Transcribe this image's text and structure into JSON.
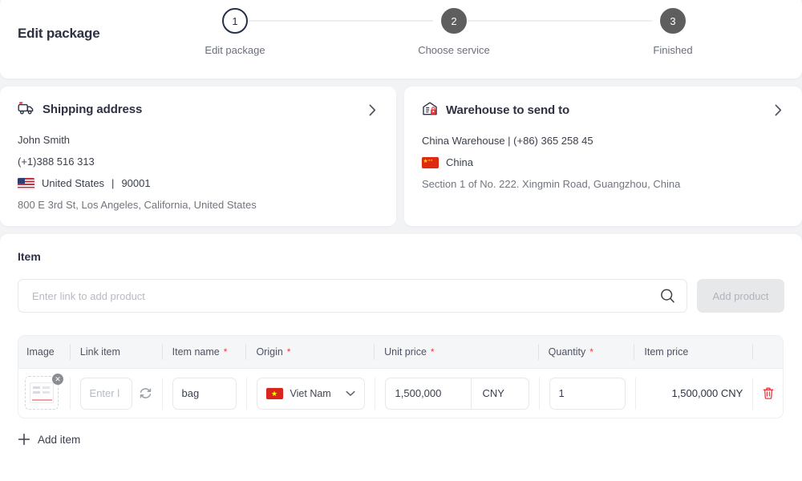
{
  "header": {
    "title": "Edit package",
    "steps": [
      {
        "number": "1",
        "label": "Edit package",
        "state": "active"
      },
      {
        "number": "2",
        "label": "Choose service",
        "state": "inactive"
      },
      {
        "number": "3",
        "label": "Finished",
        "state": "inactive"
      }
    ]
  },
  "shipping_address": {
    "heading": "Shipping address",
    "icon": "truck-icon",
    "name": "John Smith",
    "phone": "(+1)388 516 313",
    "country": "United States",
    "separator": "|",
    "postal_code": "90001",
    "address": "800 E 3rd St, Los Angeles, California, United States",
    "flag": "us-flag-icon"
  },
  "warehouse": {
    "heading": "Warehouse to send to",
    "icon": "warehouse-icon",
    "name_and_phone": "China Warehouse  |  (+86) 365 258 45",
    "country": "China",
    "address": "Section 1 of No. 222. Xingmin Road, Guangzhou, China",
    "flag": "cn-flag-icon"
  },
  "item_section": {
    "title": "Item",
    "search_placeholder": "Enter link to add product",
    "search_value": "",
    "add_product_label": "Add product",
    "add_item_label": "Add item",
    "table": {
      "columns": [
        {
          "label": "Image",
          "required": false
        },
        {
          "label": "Link item",
          "required": false
        },
        {
          "label": "Item name",
          "required": true
        },
        {
          "label": "Origin",
          "required": true
        },
        {
          "label": "Unit price",
          "required": true
        },
        {
          "label": "Quantity",
          "required": true
        },
        {
          "label": "Item price",
          "required": false
        }
      ],
      "required_marker": "*",
      "rows": [
        {
          "link_placeholder": "Enter l",
          "link_value": "",
          "item_name": "bag",
          "origin": "Viet Nam",
          "origin_flag": "vn-flag-icon",
          "unit_price": "1,500,000",
          "currency": "CNY",
          "quantity": "1",
          "item_price": "1,500,000 CNY"
        }
      ]
    }
  },
  "colors": {
    "page_background": "#f2f3f5",
    "card_background": "#ffffff",
    "accent_red": "#f0383f",
    "step_active": "#27304a",
    "step_inactive": "#5e5e5e",
    "text_primary": "#2d3142",
    "text_muted": "#70757f"
  }
}
